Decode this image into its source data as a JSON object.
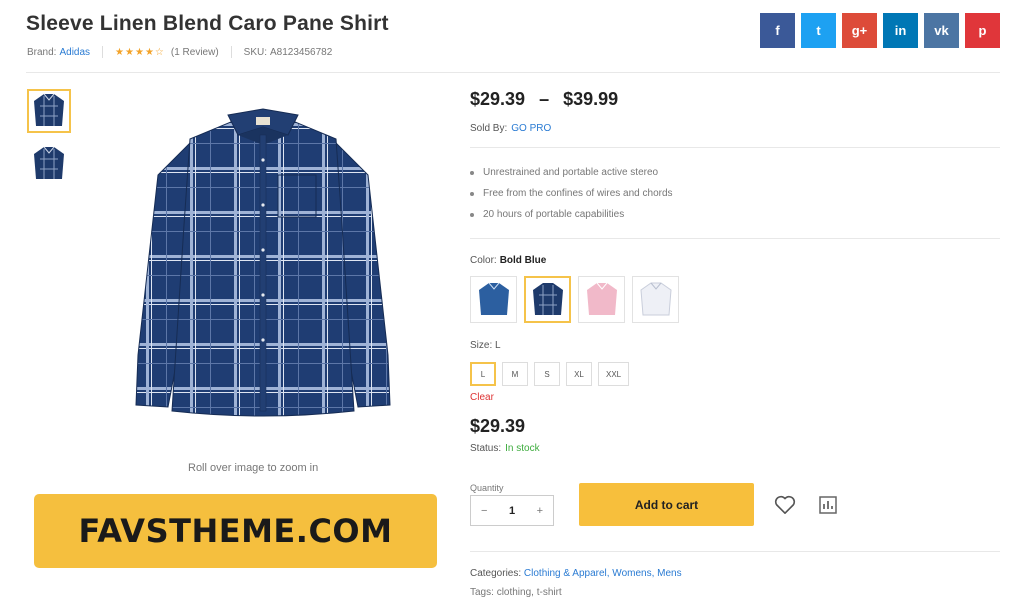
{
  "product": {
    "title": "Sleeve Linen Blend Caro Pane Shirt",
    "brand_label": "Brand:",
    "brand_value": "Adidas",
    "stars": "★★★★☆",
    "reviews": "(1 Review)",
    "sku_label": "SKU:",
    "sku_value": "A8123456782"
  },
  "social": {
    "items": [
      {
        "icon": "facebook-icon",
        "glyph": "f",
        "color": "#3b5998"
      },
      {
        "icon": "twitter-icon",
        "glyph": "t",
        "color": "#1da1f2"
      },
      {
        "icon": "google-plus-icon",
        "glyph": "g+",
        "color": "#dd4b39"
      },
      {
        "icon": "linkedin-icon",
        "glyph": "in",
        "color": "#0077b5"
      },
      {
        "icon": "vk-icon",
        "glyph": "vk",
        "color": "#4c75a3"
      },
      {
        "icon": "pinterest-icon",
        "glyph": "p",
        "color": "#e0363a"
      }
    ]
  },
  "gallery": {
    "zoom_hint": "Roll over image to zoom in"
  },
  "banner": {
    "text": "FAVSTHEME.COM",
    "color": "#f5bf3e"
  },
  "pricing": {
    "min": "$29.39",
    "dash": "–",
    "max": "$39.99",
    "sold_by_label": "Sold By:",
    "sold_by_value": "GO PRO"
  },
  "features": [
    "Unrestrained and portable active stereo",
    "Free from the confines of wires and chords",
    "20 hours of portable capabilities"
  ],
  "color": {
    "label": "Color:",
    "selected": "Bold Blue",
    "swatches": [
      "denim-blue",
      "navy-plaid",
      "pink",
      "white"
    ]
  },
  "size": {
    "label": "Size:",
    "selected": "L",
    "options": [
      "L",
      "M",
      "S",
      "XL",
      "XXL"
    ]
  },
  "clear_label": "Clear",
  "variation_price": "$29.39",
  "status": {
    "label": "Status:",
    "value": "In stock",
    "color": "#3dac3d"
  },
  "cart": {
    "quantity_label": "Quantity",
    "minus": "−",
    "quantity": "1",
    "plus": "+",
    "add_label": "Add to cart",
    "button_color": "#f7bf3c"
  },
  "categories": {
    "label": "Categories:",
    "value": "Clothing & Apparel, Womens, Mens"
  },
  "tags": {
    "label": "Tags:",
    "value": "clothing, t-shirt"
  }
}
